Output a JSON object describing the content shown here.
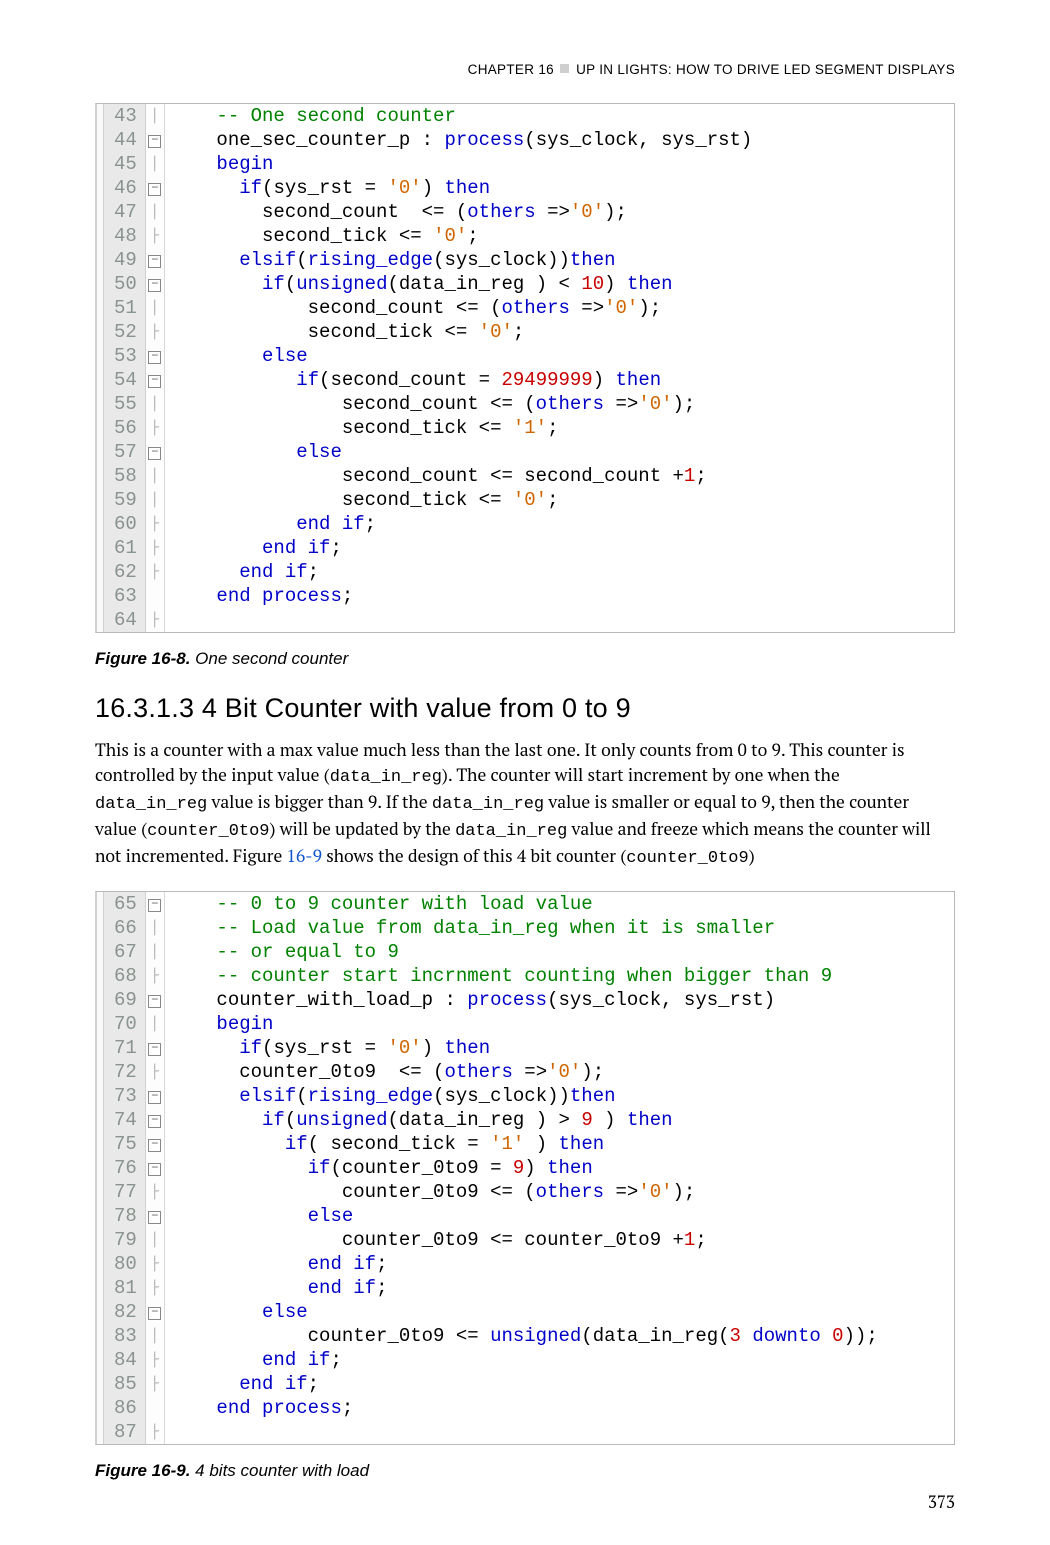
{
  "running_head": {
    "prefix": "CHAPTER 16",
    "suffix": "UP IN LIGHTS: HOW TO DRIVE LED SEGMENT DISPLAYS"
  },
  "code1": {
    "lines": [
      {
        "n": "43",
        "fold": "|",
        "seg": [
          {
            "c": "black",
            "t": "    "
          },
          {
            "c": "green",
            "t": "-- One second counter"
          }
        ]
      },
      {
        "n": "44",
        "fold": "⊟",
        "seg": [
          {
            "c": "black",
            "t": "    one_sec_counter_p : "
          },
          {
            "c": "blue",
            "t": "process"
          },
          {
            "c": "black",
            "t": "(sys_clock, sys_rst)"
          }
        ]
      },
      {
        "n": "45",
        "fold": "|",
        "seg": [
          {
            "c": "black",
            "t": "    "
          },
          {
            "c": "blue",
            "t": "begin"
          }
        ]
      },
      {
        "n": "46",
        "fold": "⊟",
        "seg": [
          {
            "c": "black",
            "t": "      "
          },
          {
            "c": "blue",
            "t": "if"
          },
          {
            "c": "black",
            "t": "(sys_rst = "
          },
          {
            "c": "orange",
            "t": "'0'"
          },
          {
            "c": "black",
            "t": ") "
          },
          {
            "c": "blue",
            "t": "then"
          }
        ]
      },
      {
        "n": "47",
        "fold": "|",
        "seg": [
          {
            "c": "black",
            "t": "        second_count  <= ("
          },
          {
            "c": "blue",
            "t": "others"
          },
          {
            "c": "black",
            "t": " =>"
          },
          {
            "c": "orange",
            "t": "'0'"
          },
          {
            "c": "black",
            "t": ");"
          }
        ]
      },
      {
        "n": "48",
        "fold": "├",
        "seg": [
          {
            "c": "black",
            "t": "        second_tick <= "
          },
          {
            "c": "orange",
            "t": "'0'"
          },
          {
            "c": "black",
            "t": ";"
          }
        ]
      },
      {
        "n": "49",
        "fold": "⊟",
        "seg": [
          {
            "c": "black",
            "t": "      "
          },
          {
            "c": "blue",
            "t": "elsif"
          },
          {
            "c": "black",
            "t": "("
          },
          {
            "c": "blue",
            "t": "rising_edge"
          },
          {
            "c": "black",
            "t": "(sys_clock))"
          },
          {
            "c": "blue",
            "t": "then"
          }
        ]
      },
      {
        "n": "50",
        "fold": "⊟",
        "seg": [
          {
            "c": "black",
            "t": "        "
          },
          {
            "c": "blue",
            "t": "if"
          },
          {
            "c": "black",
            "t": "("
          },
          {
            "c": "blue",
            "t": "unsigned"
          },
          {
            "c": "black",
            "t": "(data_in_reg ) < "
          },
          {
            "c": "red",
            "t": "10"
          },
          {
            "c": "black",
            "t": ") "
          },
          {
            "c": "blue",
            "t": "then"
          }
        ]
      },
      {
        "n": "51",
        "fold": "|",
        "seg": [
          {
            "c": "black",
            "t": "            second_count <= ("
          },
          {
            "c": "blue",
            "t": "others"
          },
          {
            "c": "black",
            "t": " =>"
          },
          {
            "c": "orange",
            "t": "'0'"
          },
          {
            "c": "black",
            "t": ");"
          }
        ]
      },
      {
        "n": "52",
        "fold": "├",
        "seg": [
          {
            "c": "black",
            "t": "            second_tick <= "
          },
          {
            "c": "orange",
            "t": "'0'"
          },
          {
            "c": "black",
            "t": ";"
          }
        ]
      },
      {
        "n": "53",
        "fold": "⊟",
        "seg": [
          {
            "c": "black",
            "t": "        "
          },
          {
            "c": "blue",
            "t": "else"
          }
        ]
      },
      {
        "n": "54",
        "fold": "⊟",
        "seg": [
          {
            "c": "black",
            "t": "           "
          },
          {
            "c": "blue",
            "t": "if"
          },
          {
            "c": "black",
            "t": "(second_count = "
          },
          {
            "c": "red",
            "t": "29499999"
          },
          {
            "c": "black",
            "t": ") "
          },
          {
            "c": "blue",
            "t": "then"
          }
        ]
      },
      {
        "n": "55",
        "fold": "|",
        "seg": [
          {
            "c": "black",
            "t": "               second_count <= ("
          },
          {
            "c": "blue",
            "t": "others"
          },
          {
            "c": "black",
            "t": " =>"
          },
          {
            "c": "orange",
            "t": "'0'"
          },
          {
            "c": "black",
            "t": ");"
          }
        ]
      },
      {
        "n": "56",
        "fold": "├",
        "seg": [
          {
            "c": "black",
            "t": "               second_tick <= "
          },
          {
            "c": "orange",
            "t": "'1'"
          },
          {
            "c": "black",
            "t": ";"
          }
        ]
      },
      {
        "n": "57",
        "fold": "⊟",
        "seg": [
          {
            "c": "black",
            "t": "           "
          },
          {
            "c": "blue",
            "t": "else"
          }
        ]
      },
      {
        "n": "58",
        "fold": "|",
        "seg": [
          {
            "c": "black",
            "t": "               second_count <= second_count +"
          },
          {
            "c": "red",
            "t": "1"
          },
          {
            "c": "black",
            "t": ";"
          }
        ]
      },
      {
        "n": "59",
        "fold": "|",
        "seg": [
          {
            "c": "black",
            "t": "               second_tick <= "
          },
          {
            "c": "orange",
            "t": "'0'"
          },
          {
            "c": "black",
            "t": ";"
          }
        ]
      },
      {
        "n": "60",
        "fold": "├",
        "seg": [
          {
            "c": "black",
            "t": "           "
          },
          {
            "c": "blue",
            "t": "end"
          },
          {
            "c": "black",
            "t": " "
          },
          {
            "c": "blue",
            "t": "if"
          },
          {
            "c": "black",
            "t": ";"
          }
        ]
      },
      {
        "n": "61",
        "fold": "├",
        "seg": [
          {
            "c": "black",
            "t": "        "
          },
          {
            "c": "blue",
            "t": "end"
          },
          {
            "c": "black",
            "t": " "
          },
          {
            "c": "blue",
            "t": "if"
          },
          {
            "c": "black",
            "t": ";"
          }
        ]
      },
      {
        "n": "62",
        "fold": "├",
        "seg": [
          {
            "c": "black",
            "t": "      "
          },
          {
            "c": "blue",
            "t": "end"
          },
          {
            "c": "black",
            "t": " "
          },
          {
            "c": "blue",
            "t": "if"
          },
          {
            "c": "black",
            "t": ";"
          }
        ]
      },
      {
        "n": "63",
        "fold": " ",
        "seg": [
          {
            "c": "black",
            "t": "    "
          },
          {
            "c": "blue",
            "t": "end"
          },
          {
            "c": "black",
            "t": " "
          },
          {
            "c": "blue",
            "t": "process"
          },
          {
            "c": "black",
            "t": ";"
          }
        ]
      },
      {
        "n": "64",
        "fold": "├",
        "seg": [
          {
            "c": "black",
            "t": " "
          }
        ]
      }
    ]
  },
  "fig1": {
    "label": "Figure 16-8.",
    "title": " One second counter"
  },
  "section": {
    "number": "16.3.1.3",
    "title": "   4 Bit Counter with value from 0 to 9"
  },
  "para": {
    "p1": "This is a counter with a max value much less than the last one. It only counts from 0 to 9. This counter is controlled by the input value (",
    "c1": "data_in_reg",
    "p2": "). The counter will start increment by one when the ",
    "c2": "data_in_reg",
    "p3": " value is bigger than 9. If the ",
    "c3": "data_in_reg",
    "p4": " value is smaller or equal to 9, then the counter value (",
    "c4": "counter_0to9",
    "p5": ") will be updated by the ",
    "c5": "data_in_reg",
    "p6": " value and freeze which means the counter will not incremented. Figure ",
    "ref": "16-9",
    "p7": " shows the design of this 4 bit counter (",
    "c6": "counter_0to9",
    "p8": ")"
  },
  "code2": {
    "lines": [
      {
        "n": "65",
        "fold": "⊟",
        "seg": [
          {
            "c": "black",
            "t": "    "
          },
          {
            "c": "green",
            "t": "-- 0 to 9 counter with load value"
          }
        ]
      },
      {
        "n": "66",
        "fold": "|",
        "seg": [
          {
            "c": "black",
            "t": "    "
          },
          {
            "c": "green",
            "t": "-- Load value from data_in_reg when it is smaller"
          }
        ]
      },
      {
        "n": "67",
        "fold": "|",
        "seg": [
          {
            "c": "black",
            "t": "    "
          },
          {
            "c": "green",
            "t": "-- or equal to 9"
          }
        ]
      },
      {
        "n": "68",
        "fold": "├",
        "seg": [
          {
            "c": "black",
            "t": "    "
          },
          {
            "c": "green",
            "t": "-- counter start incrnment counting when bigger than 9"
          }
        ]
      },
      {
        "n": "69",
        "fold": "⊟",
        "seg": [
          {
            "c": "black",
            "t": "    counter_with_load_p : "
          },
          {
            "c": "blue",
            "t": "process"
          },
          {
            "c": "black",
            "t": "(sys_clock, sys_rst)"
          }
        ]
      },
      {
        "n": "70",
        "fold": "|",
        "seg": [
          {
            "c": "black",
            "t": "    "
          },
          {
            "c": "blue",
            "t": "begin"
          }
        ]
      },
      {
        "n": "71",
        "fold": "⊟",
        "seg": [
          {
            "c": "black",
            "t": "      "
          },
          {
            "c": "blue",
            "t": "if"
          },
          {
            "c": "black",
            "t": "(sys_rst = "
          },
          {
            "c": "orange",
            "t": "'0'"
          },
          {
            "c": "black",
            "t": ") "
          },
          {
            "c": "blue",
            "t": "then"
          }
        ]
      },
      {
        "n": "72",
        "fold": "├",
        "seg": [
          {
            "c": "black",
            "t": "      counter_0to9  <= ("
          },
          {
            "c": "blue",
            "t": "others"
          },
          {
            "c": "black",
            "t": " =>"
          },
          {
            "c": "orange",
            "t": "'0'"
          },
          {
            "c": "black",
            "t": ");"
          }
        ]
      },
      {
        "n": "73",
        "fold": "⊟",
        "seg": [
          {
            "c": "black",
            "t": "      "
          },
          {
            "c": "blue",
            "t": "elsif"
          },
          {
            "c": "black",
            "t": "("
          },
          {
            "c": "blue",
            "t": "rising_edge"
          },
          {
            "c": "black",
            "t": "(sys_clock))"
          },
          {
            "c": "blue",
            "t": "then"
          }
        ]
      },
      {
        "n": "74",
        "fold": "⊟",
        "seg": [
          {
            "c": "black",
            "t": "        "
          },
          {
            "c": "blue",
            "t": "if"
          },
          {
            "c": "black",
            "t": "("
          },
          {
            "c": "blue",
            "t": "unsigned"
          },
          {
            "c": "black",
            "t": "(data_in_reg ) > "
          },
          {
            "c": "red",
            "t": "9"
          },
          {
            "c": "black",
            "t": " ) "
          },
          {
            "c": "blue",
            "t": "then"
          }
        ]
      },
      {
        "n": "75",
        "fold": "⊟",
        "seg": [
          {
            "c": "black",
            "t": "          "
          },
          {
            "c": "blue",
            "t": "if"
          },
          {
            "c": "black",
            "t": "( second_tick = "
          },
          {
            "c": "orange",
            "t": "'1'"
          },
          {
            "c": "black",
            "t": " ) "
          },
          {
            "c": "blue",
            "t": "then"
          }
        ]
      },
      {
        "n": "76",
        "fold": "⊟",
        "seg": [
          {
            "c": "black",
            "t": "            "
          },
          {
            "c": "blue",
            "t": "if"
          },
          {
            "c": "black",
            "t": "(counter_0to9 = "
          },
          {
            "c": "red",
            "t": "9"
          },
          {
            "c": "black",
            "t": ") "
          },
          {
            "c": "blue",
            "t": "then"
          }
        ]
      },
      {
        "n": "77",
        "fold": "├",
        "seg": [
          {
            "c": "black",
            "t": "               counter_0to9 <= ("
          },
          {
            "c": "blue",
            "t": "others"
          },
          {
            "c": "black",
            "t": " =>"
          },
          {
            "c": "orange",
            "t": "'0'"
          },
          {
            "c": "black",
            "t": ");"
          }
        ]
      },
      {
        "n": "78",
        "fold": "⊟",
        "seg": [
          {
            "c": "black",
            "t": "            "
          },
          {
            "c": "blue",
            "t": "else"
          }
        ]
      },
      {
        "n": "79",
        "fold": "|",
        "seg": [
          {
            "c": "black",
            "t": "               counter_0to9 <= counter_0to9 +"
          },
          {
            "c": "red",
            "t": "1"
          },
          {
            "c": "black",
            "t": ";"
          }
        ]
      },
      {
        "n": "80",
        "fold": "├",
        "seg": [
          {
            "c": "black",
            "t": "            "
          },
          {
            "c": "blue",
            "t": "end"
          },
          {
            "c": "black",
            "t": " "
          },
          {
            "c": "blue",
            "t": "if"
          },
          {
            "c": "black",
            "t": ";"
          }
        ]
      },
      {
        "n": "81",
        "fold": "├",
        "seg": [
          {
            "c": "black",
            "t": "            "
          },
          {
            "c": "blue",
            "t": "end"
          },
          {
            "c": "black",
            "t": " "
          },
          {
            "c": "blue",
            "t": "if"
          },
          {
            "c": "black",
            "t": ";"
          }
        ]
      },
      {
        "n": "82",
        "fold": "⊟",
        "seg": [
          {
            "c": "black",
            "t": "        "
          },
          {
            "c": "blue",
            "t": "else"
          }
        ]
      },
      {
        "n": "83",
        "fold": "|",
        "seg": [
          {
            "c": "black",
            "t": "            counter_0to9 <= "
          },
          {
            "c": "blue",
            "t": "unsigned"
          },
          {
            "c": "black",
            "t": "(data_in_reg("
          },
          {
            "c": "red",
            "t": "3"
          },
          {
            "c": "black",
            "t": " "
          },
          {
            "c": "blue",
            "t": "downto"
          },
          {
            "c": "black",
            "t": " "
          },
          {
            "c": "red",
            "t": "0"
          },
          {
            "c": "black",
            "t": "));"
          }
        ]
      },
      {
        "n": "84",
        "fold": "├",
        "seg": [
          {
            "c": "black",
            "t": "        "
          },
          {
            "c": "blue",
            "t": "end"
          },
          {
            "c": "black",
            "t": " "
          },
          {
            "c": "blue",
            "t": "if"
          },
          {
            "c": "black",
            "t": ";"
          }
        ]
      },
      {
        "n": "85",
        "fold": "├",
        "seg": [
          {
            "c": "black",
            "t": "      "
          },
          {
            "c": "blue",
            "t": "end"
          },
          {
            "c": "black",
            "t": " "
          },
          {
            "c": "blue",
            "t": "if"
          },
          {
            "c": "black",
            "t": ";"
          }
        ]
      },
      {
        "n": "86",
        "fold": " ",
        "seg": [
          {
            "c": "black",
            "t": "    "
          },
          {
            "c": "blue",
            "t": "end"
          },
          {
            "c": "black",
            "t": " "
          },
          {
            "c": "blue",
            "t": "process"
          },
          {
            "c": "black",
            "t": ";"
          }
        ]
      },
      {
        "n": "87",
        "fold": "├",
        "seg": [
          {
            "c": "black",
            "t": " "
          }
        ]
      }
    ]
  },
  "fig2": {
    "label": "Figure 16-9.",
    "title": " 4 bits counter with load"
  },
  "page_number": "373"
}
